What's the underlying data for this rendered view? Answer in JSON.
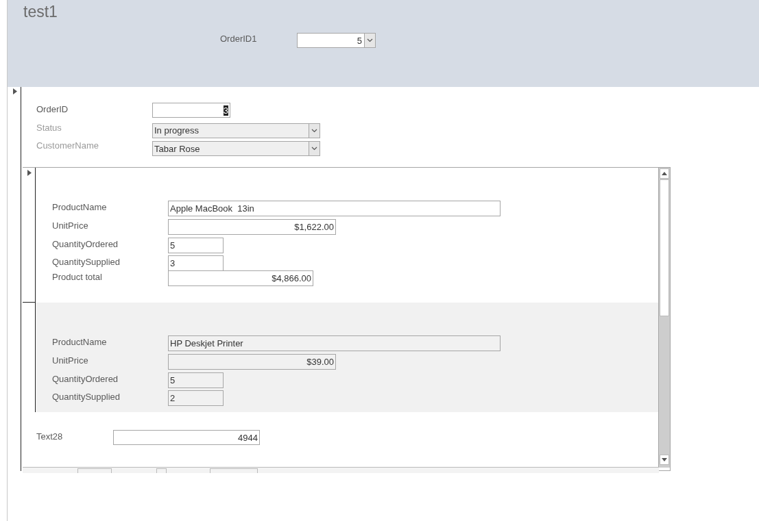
{
  "header": {
    "title": "test1",
    "filter": {
      "label": "OrderID1",
      "value": "5",
      "kind": "combo"
    }
  },
  "record_selected": true,
  "fields": [
    {
      "label": "OrderID",
      "value": "3",
      "kind": "text",
      "disabled": false,
      "text_selected": true
    },
    {
      "label": "Status",
      "value": "In progress",
      "kind": "combo",
      "disabled": true
    },
    {
      "label": "CustomerName",
      "value": "Tabar Rose",
      "kind": "combo",
      "disabled": true
    }
  ],
  "subform": {
    "records": [
      {
        "selected": true,
        "fields": [
          {
            "label": "ProductName",
            "value": "Apple MacBook  13in",
            "kind": "name"
          },
          {
            "label": "UnitPrice",
            "value": "$1,622.00",
            "kind": "price"
          },
          {
            "label": "QuantityOrdered",
            "value": "5",
            "kind": "qty"
          },
          {
            "label": "QuantitySupplied",
            "value": "3",
            "kind": "qty"
          },
          {
            "label": "Product total",
            "value": "$4,866.00",
            "kind": "total"
          }
        ]
      },
      {
        "selected": false,
        "fields": [
          {
            "label": "ProductName",
            "value": "HP Deskjet Printer",
            "kind": "name"
          },
          {
            "label": "UnitPrice",
            "value": "$39.00",
            "kind": "price"
          },
          {
            "label": "QuantityOrdered",
            "value": "5",
            "kind": "qty"
          },
          {
            "label": "QuantitySupplied",
            "value": "2",
            "kind": "qty"
          }
        ]
      }
    ],
    "footer": {
      "label": "Text28",
      "value": "4944"
    }
  }
}
